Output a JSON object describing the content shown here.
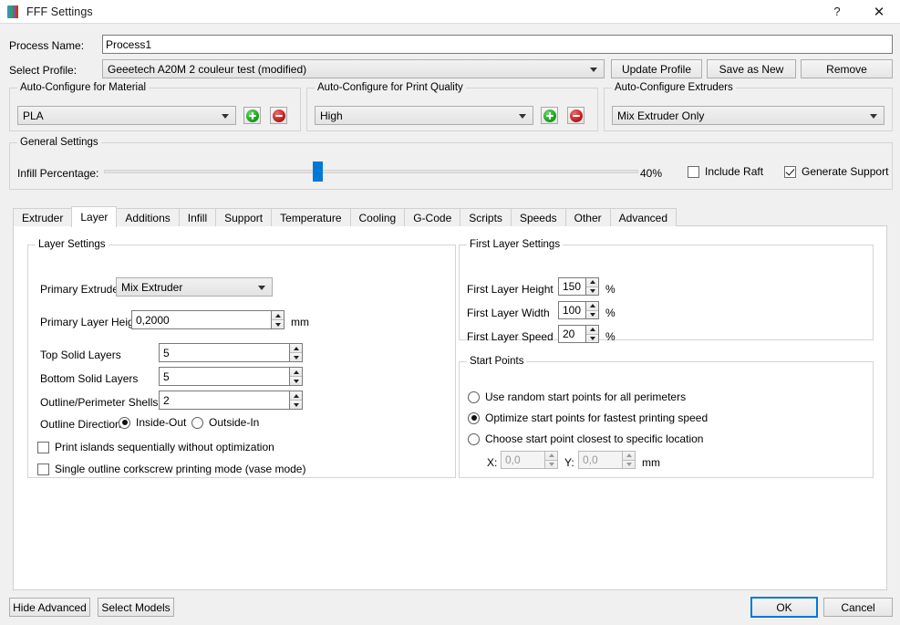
{
  "window": {
    "title": "FFF Settings",
    "app_icon": "simplify3d-logo-icon",
    "help_label": "?",
    "close_label": "✕"
  },
  "top": {
    "process_name_label": "Process Name:",
    "process_name_value": "Process1",
    "select_profile_label": "Select Profile:",
    "select_profile_value": "Geeetech A20M 2 couleur test (modified)",
    "update_profile_label": "Update Profile",
    "save_as_new_label": "Save as New",
    "remove_label": "Remove"
  },
  "auto_material": {
    "title": "Auto-Configure for Material",
    "value": "PLA",
    "add_label": "+",
    "remove_label": "−"
  },
  "auto_quality": {
    "title": "Auto-Configure for Print Quality",
    "value": "High",
    "add_label": "+",
    "remove_label": "−"
  },
  "auto_extruders": {
    "title": "Auto-Configure Extruders",
    "value": "Mix Extruder Only"
  },
  "general": {
    "title": "General Settings",
    "infill_label": "Infill Percentage:",
    "infill_value": "40%",
    "infill_percent": 40,
    "include_raft_label": "Include Raft",
    "include_raft_checked": false,
    "generate_support_label": "Generate Support",
    "generate_support_checked": true,
    "slider_color": "#0078d7"
  },
  "tabs": [
    {
      "label": "Extruder",
      "active": false
    },
    {
      "label": "Layer",
      "active": true
    },
    {
      "label": "Additions",
      "active": false
    },
    {
      "label": "Infill",
      "active": false
    },
    {
      "label": "Support",
      "active": false
    },
    {
      "label": "Temperature",
      "active": false
    },
    {
      "label": "Cooling",
      "active": false
    },
    {
      "label": "G-Code",
      "active": false
    },
    {
      "label": "Scripts",
      "active": false
    },
    {
      "label": "Speeds",
      "active": false
    },
    {
      "label": "Other",
      "active": false
    },
    {
      "label": "Advanced",
      "active": false
    }
  ],
  "layer_settings": {
    "title": "Layer Settings",
    "primary_extruder_label": "Primary Extruder",
    "primary_extruder_value": "Mix Extruder",
    "primary_layer_height_label": "Primary Layer Height",
    "primary_layer_height_value": "0,2000",
    "primary_layer_height_unit": "mm",
    "top_solid_layers_label": "Top Solid Layers",
    "top_solid_layers_value": "5",
    "bottom_solid_layers_label": "Bottom Solid Layers",
    "bottom_solid_layers_value": "5",
    "outline_shells_label": "Outline/Perimeter Shells",
    "outline_shells_value": "2",
    "outline_direction_label": "Outline Direction:",
    "inside_out_label": "Inside-Out",
    "inside_out_selected": true,
    "outside_in_label": "Outside-In",
    "outside_in_selected": false,
    "print_islands_label": "Print islands sequentially without optimization",
    "print_islands_checked": false,
    "vase_mode_label": "Single outline corkscrew printing mode (vase mode)",
    "vase_mode_checked": false
  },
  "first_layer": {
    "title": "First Layer Settings",
    "height_label": "First Layer Height",
    "height_value": "150",
    "height_unit": "%",
    "width_label": "First Layer Width",
    "width_value": "100",
    "width_unit": "%",
    "speed_label": "First Layer Speed",
    "speed_value": "20",
    "speed_unit": "%"
  },
  "start_points": {
    "title": "Start Points",
    "random_label": "Use random start points for all perimeters",
    "random_selected": false,
    "optimize_label": "Optimize start points for fastest printing speed",
    "optimize_selected": true,
    "specific_label": "Choose start point closest to specific location",
    "specific_selected": false,
    "x_label": "X:",
    "x_value": "0,0",
    "y_label": "Y:",
    "y_value": "0,0",
    "unit": "mm"
  },
  "footer": {
    "hide_advanced_label": "Hide Advanced",
    "select_models_label": "Select Models",
    "ok_label": "OK",
    "cancel_label": "Cancel"
  }
}
